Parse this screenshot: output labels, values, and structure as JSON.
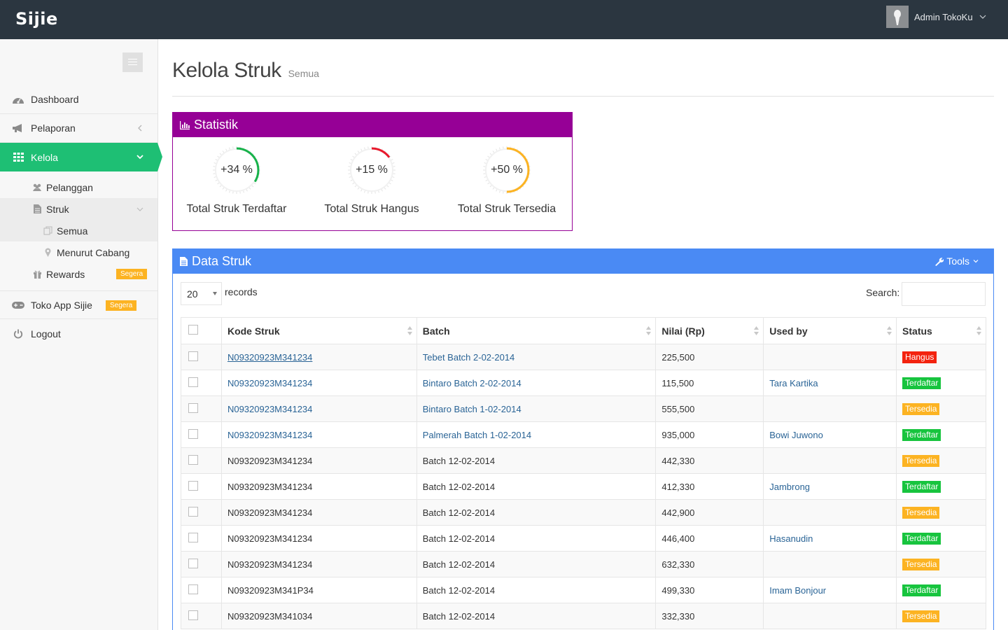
{
  "app": {
    "logo": "Sijie",
    "user_name": "Admin TokoKu"
  },
  "sidebar": {
    "items": [
      {
        "label": "Dashboard",
        "icon": "dashboard-icon"
      },
      {
        "label": "Pelaporan",
        "icon": "bullhorn-icon"
      },
      {
        "label": "Kelola",
        "icon": "grid-icon",
        "active": true
      },
      {
        "label": "Toko App Sijie",
        "icon": "gamepad-icon",
        "badge": "Segera"
      },
      {
        "label": "Logout",
        "icon": "power-icon"
      }
    ],
    "sub_items": [
      {
        "label": "Pelanggan",
        "icon": "users-icon"
      },
      {
        "label": "Struk",
        "icon": "file-icon"
      },
      {
        "label": "Semua",
        "icon": "copy-icon"
      },
      {
        "label": "Menurut Cabang",
        "icon": "map-marker-icon"
      },
      {
        "label": "Rewards",
        "icon": "gift-icon",
        "badge": "Segera"
      }
    ]
  },
  "page": {
    "title": "Kelola Struk",
    "subtitle": "Semua"
  },
  "stats": {
    "title": "Statistik",
    "gauges": [
      {
        "value": "+34 %",
        "label": "Total Struk Terdaftar",
        "color": "#17b24a",
        "fraction": 0.34
      },
      {
        "value": "+15 %",
        "label": "Total Struk Hangus",
        "color": "#e8192c",
        "fraction": 0.15
      },
      {
        "value": "+50 %",
        "label": "Total Struk Tersedia",
        "color": "#fcb322",
        "fraction": 0.5
      }
    ]
  },
  "data_panel": {
    "title": "Data Struk",
    "tools_label": "Tools",
    "page_length": "20",
    "records_label": "records",
    "search_label": "Search:",
    "columns": [
      "Kode Struk",
      "Batch",
      "Nilai (Rp)",
      "Used by",
      "Status"
    ],
    "rows": [
      {
        "kode": "N09320923M341234",
        "batch": "Tebet Batch 2-02-2014",
        "nilai": "225,500",
        "used_by": "",
        "status": "Hangus",
        "linked": true,
        "underline": true
      },
      {
        "kode": "N09320923M341234",
        "batch": "Bintaro Batch 2-02-2014",
        "nilai": "115,500",
        "used_by": "Tara Kartika",
        "status": "Terdaftar",
        "linked": true
      },
      {
        "kode": "N09320923M341234",
        "batch": "Bintaro Batch 1-02-2014",
        "nilai": "555,500",
        "used_by": "",
        "status": "Tersedia",
        "linked": true
      },
      {
        "kode": "N09320923M341234",
        "batch": "Palmerah Batch 1-02-2014",
        "nilai": "935,000",
        "used_by": "Bowi Juwono",
        "status": "Terdaftar",
        "linked": true
      },
      {
        "kode": "N09320923M341234",
        "batch": "Batch 12-02-2014",
        "nilai": "442,330",
        "used_by": "",
        "status": "Tersedia"
      },
      {
        "kode": "N09320923M341234",
        "batch": "Batch 12-02-2014",
        "nilai": "412,330",
        "used_by": "Jambrong",
        "status": "Terdaftar"
      },
      {
        "kode": "N09320923M341234",
        "batch": "Batch 12-02-2014",
        "nilai": "442,900",
        "used_by": "",
        "status": "Tersedia"
      },
      {
        "kode": "N09320923M341234",
        "batch": "Batch 12-02-2014",
        "nilai": "446,400",
        "used_by": "Hasanudin",
        "status": "Terdaftar"
      },
      {
        "kode": "N09320923M341234",
        "batch": "Batch 12-02-2014",
        "nilai": "632,330",
        "used_by": "",
        "status": "Tersedia"
      },
      {
        "kode": "N09320923M341P34",
        "batch": "Batch 12-02-2014",
        "nilai": "499,330",
        "used_by": "Imam Bonjour",
        "status": "Terdaftar"
      },
      {
        "kode": "N09320923M341034",
        "batch": "Batch 12-02-2014",
        "nilai": "332,330",
        "used_by": "",
        "status": "Tersedia"
      }
    ]
  }
}
